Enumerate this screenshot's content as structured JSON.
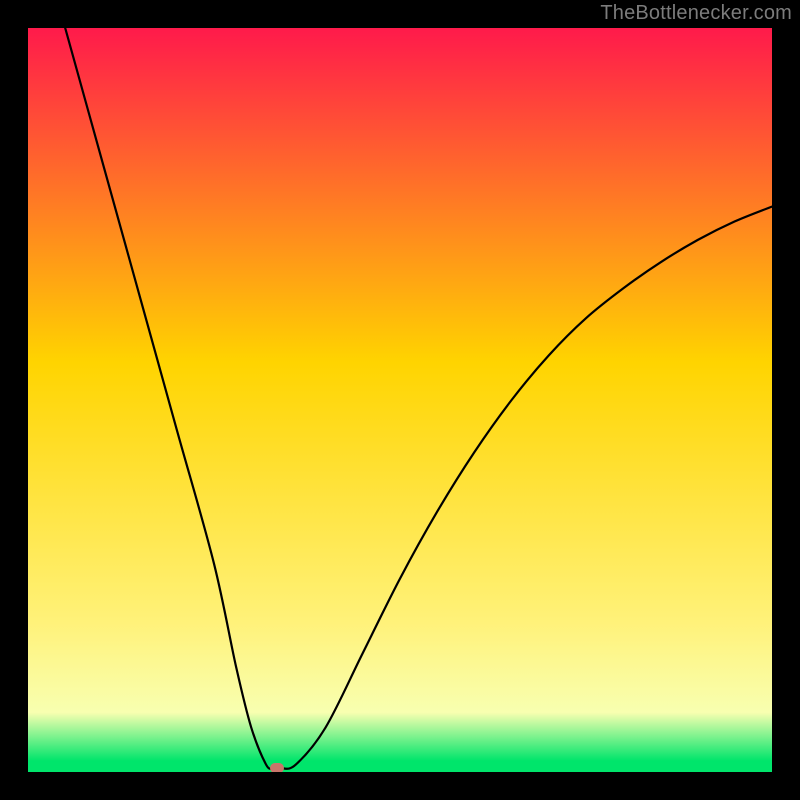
{
  "watermark": "TheBottlenecker.com",
  "colors": {
    "top": "#ff1a4b",
    "mid": "#ffd400",
    "low1": "#fff27a",
    "low2": "#f8ffb0",
    "bottom": "#00e56b",
    "curve": "#000000",
    "marker": "#c8756a",
    "frame": "#000000"
  },
  "gradient_stops": [
    {
      "offset": 0.0,
      "key": "top"
    },
    {
      "offset": 0.45,
      "key": "mid"
    },
    {
      "offset": 0.8,
      "key": "low1"
    },
    {
      "offset": 0.92,
      "key": "low2"
    },
    {
      "offset": 0.985,
      "key": "bottom"
    },
    {
      "offset": 1.0,
      "key": "bottom"
    }
  ],
  "chart_data": {
    "type": "line",
    "title": "",
    "xlabel": "",
    "ylabel": "",
    "xlim": [
      0,
      100
    ],
    "ylim": [
      0,
      100
    ],
    "series": [
      {
        "name": "bottleneck-curve",
        "x": [
          5,
          10,
          15,
          20,
          25,
          28,
          30,
          32,
          33,
          34,
          36,
          40,
          45,
          50,
          55,
          60,
          65,
          70,
          75,
          80,
          85,
          90,
          95,
          100
        ],
        "values": [
          100,
          82,
          64,
          46,
          28,
          14,
          6,
          1,
          0.5,
          0.5,
          1,
          6,
          16,
          26,
          35,
          43,
          50,
          56,
          61,
          65,
          68.5,
          71.5,
          74,
          76
        ]
      }
    ],
    "marker": {
      "x": 33.5,
      "y": 0.5
    }
  }
}
